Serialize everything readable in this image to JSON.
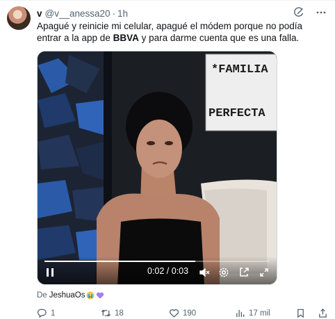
{
  "tweet": {
    "display_name": "v",
    "handle": "@v__anessa20",
    "separator": "·",
    "time": "1h",
    "text_part1": "Apagué y reinicie mi celular, apagué el módem porque no podía entrar a la app de ",
    "text_bold": "BBVA",
    "text_part2": " y para darme cuenta que es una falla."
  },
  "header_icons": [
    "grok-icon",
    "more-icon"
  ],
  "media": {
    "sign_line1": "*FAMILIA",
    "sign_line2": "PERFECTA",
    "timecode": "0:02 / 0:03",
    "progress_fraction": 0.67
  },
  "attribution": {
    "prefix": "De",
    "author": "JeshuaOs",
    "emojis": [
      "crying-face-emoji",
      "purple-heart-emoji"
    ]
  },
  "actions": {
    "replies": "1",
    "reposts": "18",
    "likes": "190",
    "views": "17 mil"
  },
  "colors": {
    "text_primary": "#0f1419",
    "text_secondary": "#536471",
    "border": "#cfd9de"
  }
}
